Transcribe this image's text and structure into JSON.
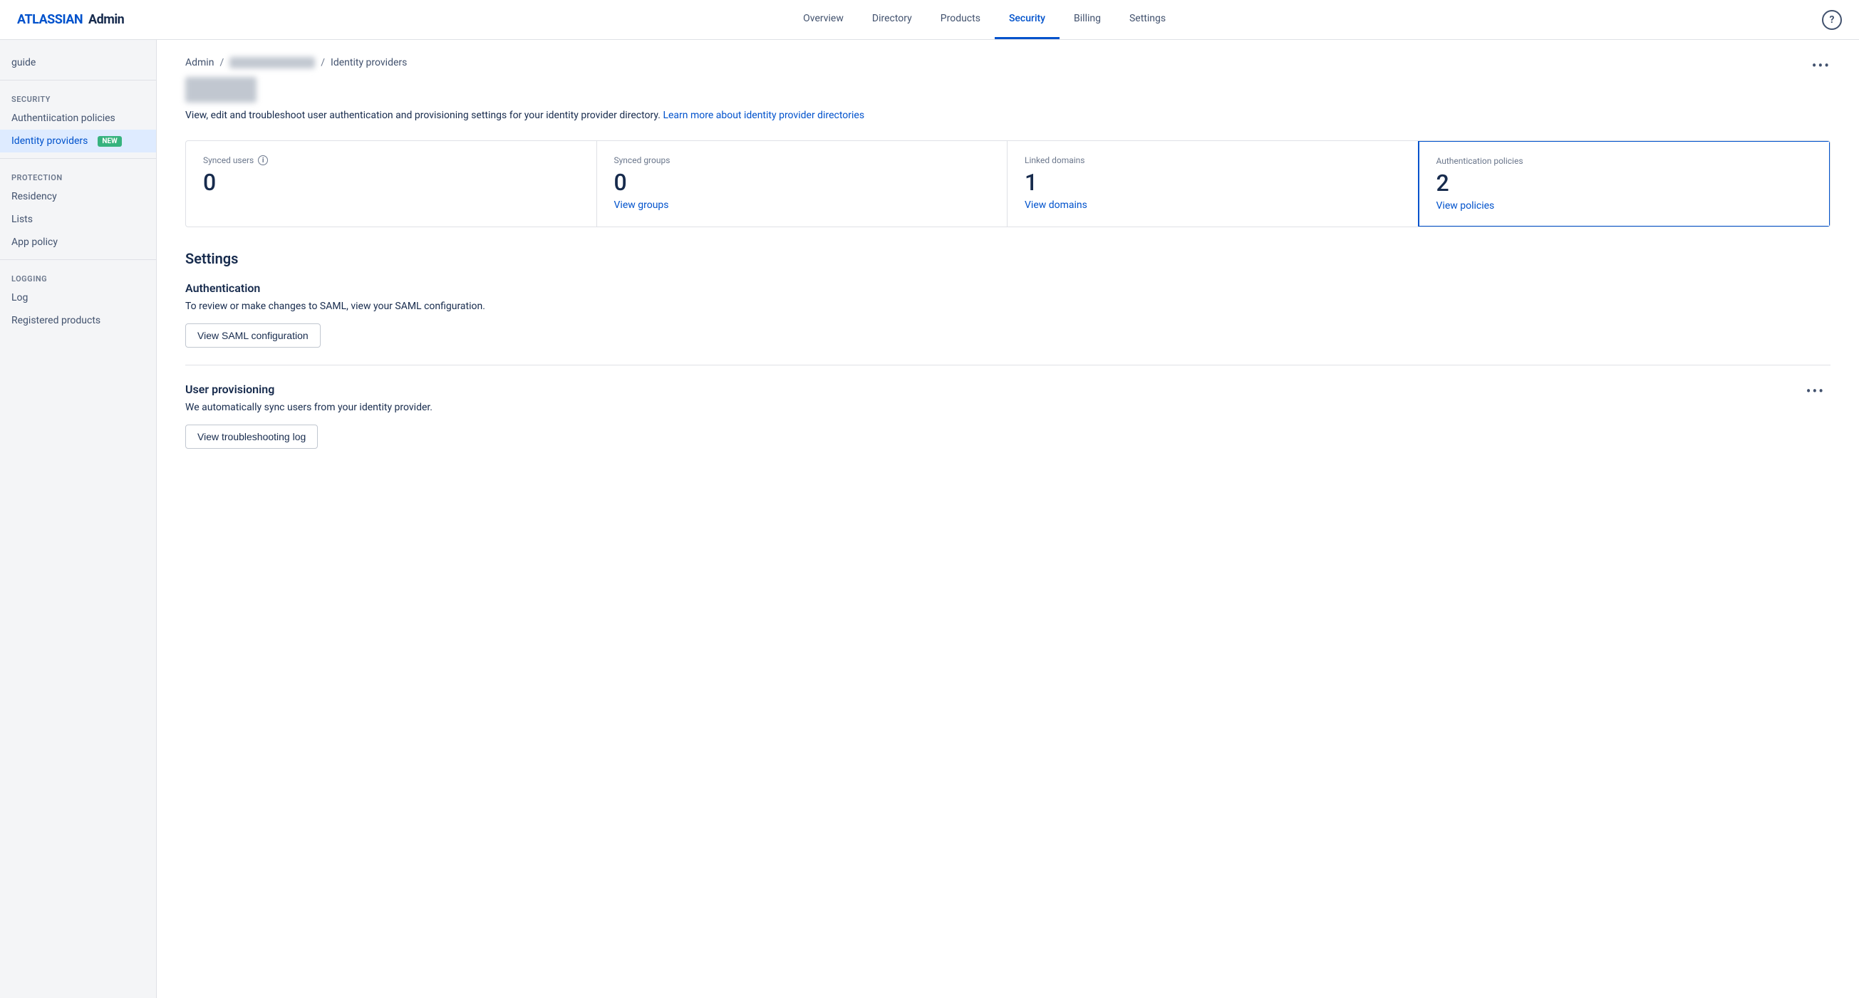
{
  "app": {
    "brand": "ATLASSIAN",
    "title": "Admin",
    "help_icon": "?"
  },
  "nav": {
    "links": [
      {
        "label": "Overview",
        "active": false,
        "id": "overview"
      },
      {
        "label": "Directory",
        "active": false,
        "id": "directory"
      },
      {
        "label": "Products",
        "active": false,
        "id": "products"
      },
      {
        "label": "Security",
        "active": true,
        "id": "security"
      },
      {
        "label": "Billing",
        "active": false,
        "id": "billing"
      },
      {
        "label": "Settings",
        "active": false,
        "id": "settings"
      }
    ]
  },
  "sidebar": {
    "guide_label": "guide",
    "sections": [
      {
        "id": "security",
        "label": "CURITY",
        "items": [
          {
            "id": "auth-policies",
            "label": "ication policies",
            "active": false
          },
          {
            "id": "id-providers",
            "label": "providers",
            "active": true,
            "badge": "NEW"
          }
        ]
      },
      {
        "id": "protection",
        "label": "OTECTION",
        "items": [
          {
            "id": "residency",
            "label": "idency",
            "active": false
          },
          {
            "id": "lists",
            "label": "sts",
            "active": false
          },
          {
            "id": "app-policy",
            "label": "pp policy",
            "active": false
          }
        ]
      },
      {
        "id": "logging",
        "label": "ING",
        "items": [
          {
            "id": "log",
            "label": "g",
            "active": false
          },
          {
            "id": "connected-products",
            "label": "red products",
            "active": false
          }
        ]
      }
    ]
  },
  "breadcrumb": {
    "admin_label": "Admin",
    "separator": "/",
    "identity_providers_label": "Identity providers"
  },
  "description": {
    "text": "View, edit and troubleshoot user authentication and provisioning settings for your identity provider directory.",
    "link_text": "Learn more about identity provider directories",
    "link_href": "#"
  },
  "stats": {
    "cards": [
      {
        "id": "synced-users",
        "label": "Synced users",
        "value": "0",
        "info_icon": true,
        "link": null,
        "highlighted": false
      },
      {
        "id": "synced-groups",
        "label": "Synced groups",
        "value": "0",
        "info_icon": false,
        "link": "View groups",
        "highlighted": false
      },
      {
        "id": "linked-domains",
        "label": "Linked domains",
        "value": "1",
        "info_icon": false,
        "link": "View domains",
        "highlighted": false
      },
      {
        "id": "auth-policies",
        "label": "Authentication policies",
        "value": "2",
        "info_icon": false,
        "link": "View policies",
        "highlighted": true
      }
    ]
  },
  "settings": {
    "section_title": "Settings",
    "authentication": {
      "heading": "Authentication",
      "description": "To review or make changes to SAML, view your SAML configuration.",
      "button_label": "View SAML configuration"
    },
    "user_provisioning": {
      "heading": "User provisioning",
      "description": "We automatically sync users from your identity provider.",
      "button_label": "View troubleshooting log"
    }
  },
  "more_menu_icon": "•••"
}
